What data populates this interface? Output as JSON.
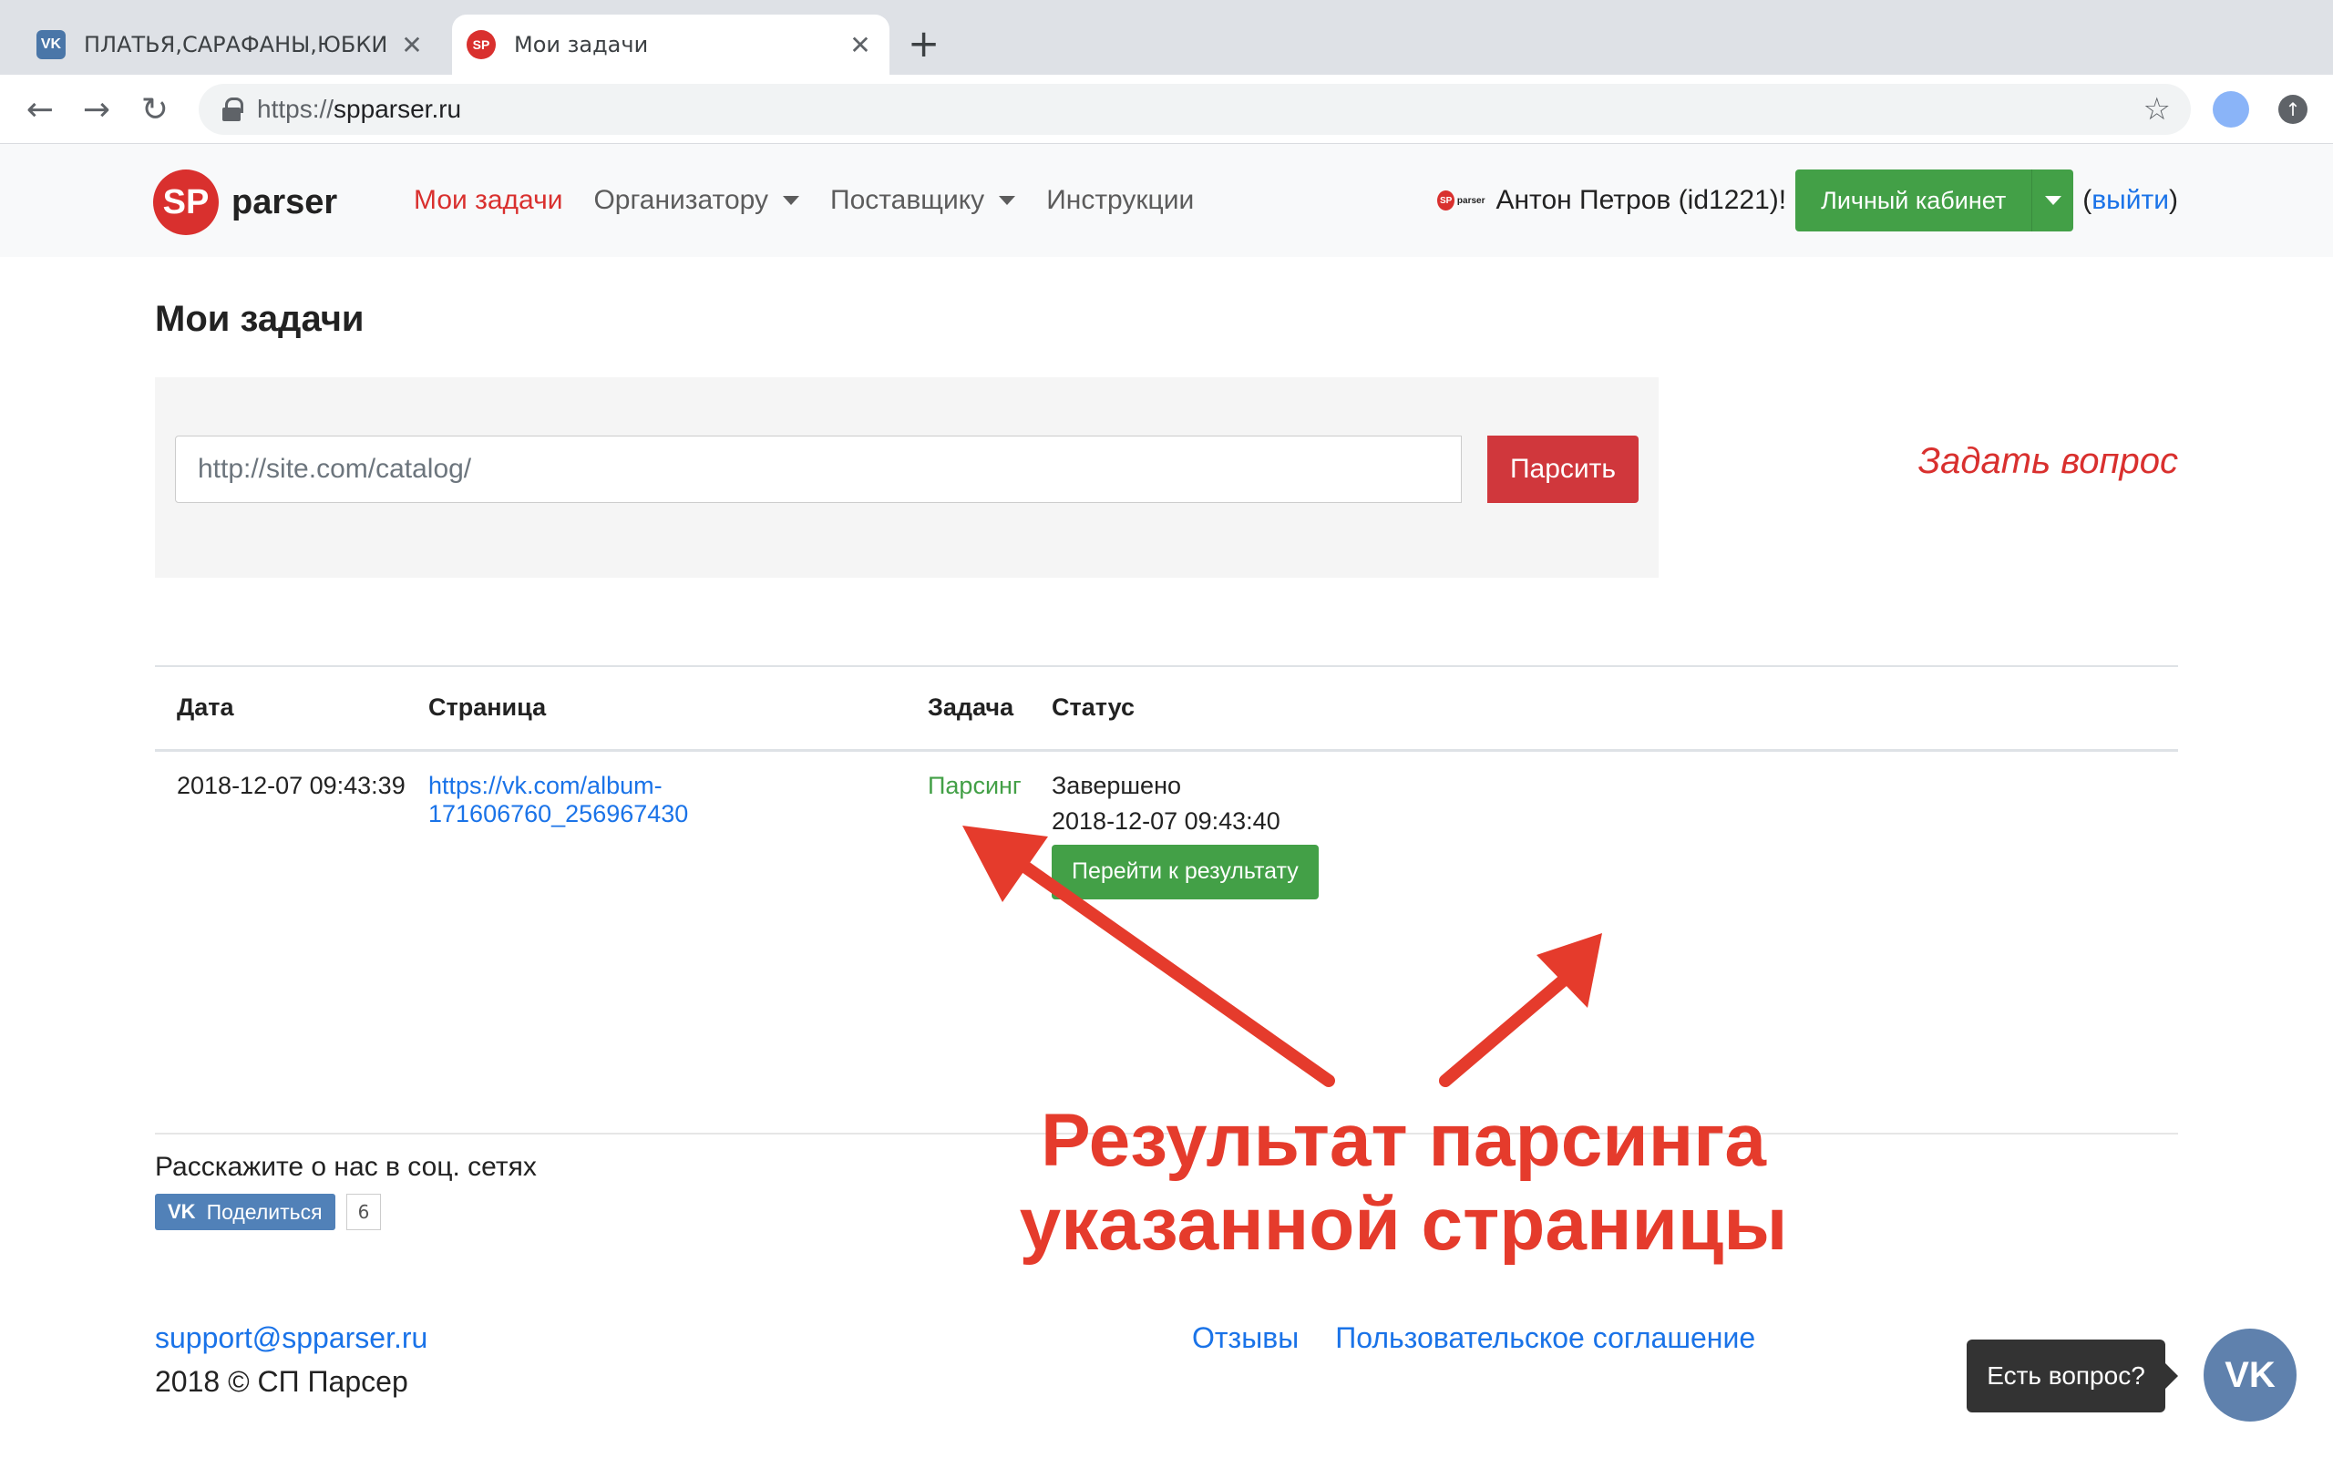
{
  "browser": {
    "tabs": [
      {
        "title": "ПЛАТЬЯ,САРАФАНЫ,ЮБКИ –",
        "favicon": "vk-icon",
        "active": false
      },
      {
        "title": "Мои задачи",
        "favicon": "spparser-icon",
        "active": true
      }
    ],
    "url_scheme": "https://",
    "url_host": "spparser.ru"
  },
  "site": {
    "logo_badge": "SP",
    "logo_word": "parser",
    "menu": [
      {
        "label": "Мои задачи",
        "active": true,
        "dropdown": false
      },
      {
        "label": "Организатору",
        "active": false,
        "dropdown": true
      },
      {
        "label": "Поставщику",
        "active": false,
        "dropdown": true
      },
      {
        "label": "Инструкции",
        "active": false,
        "dropdown": false
      }
    ],
    "mini_logo_badge": "SP",
    "mini_logo_word": "parser",
    "greeting": "Антон Петров (id1221)!",
    "cabinet_label": "Личный кабинет",
    "logout_open": "(",
    "logout_label": "выйти",
    "logout_close": ")"
  },
  "main": {
    "title": "Мои задачи",
    "parse_placeholder": "http://site.com/catalog/",
    "parse_button": "Парсить",
    "ask_link": "Задать вопрос",
    "table": {
      "headers": [
        "Дата",
        "Страница",
        "Задача",
        "Статус"
      ],
      "rows": [
        {
          "date": "2018-12-07 09:43:39",
          "page": "https://vk.com/album-171606760_256967430",
          "task": "Парсинг",
          "status": "Завершено",
          "status_time": "2018-12-07 09:43:40",
          "action": "Перейти к результату"
        }
      ]
    }
  },
  "footer": {
    "social_text": "Расскажите о нас в соц. сетях",
    "share_icon": "VK",
    "share_label": "Поделиться",
    "share_count": "6",
    "support_email": "support@spparser.ru",
    "copyright": "2018 © СП Парсер",
    "links": [
      "Отзывы",
      "Пользовательское соглашение"
    ]
  },
  "annotation": {
    "line1": "Результат парсинга",
    "line2": "указанной страницы",
    "color": "#e53b2c"
  },
  "chat": {
    "bubble": "Есть вопрос?",
    "icon": "vk-chat-icon",
    "icon_text": "VK"
  },
  "colors": {
    "brand_red": "#d9302e",
    "success_green": "#43a047",
    "link_blue": "#1a73e8"
  }
}
